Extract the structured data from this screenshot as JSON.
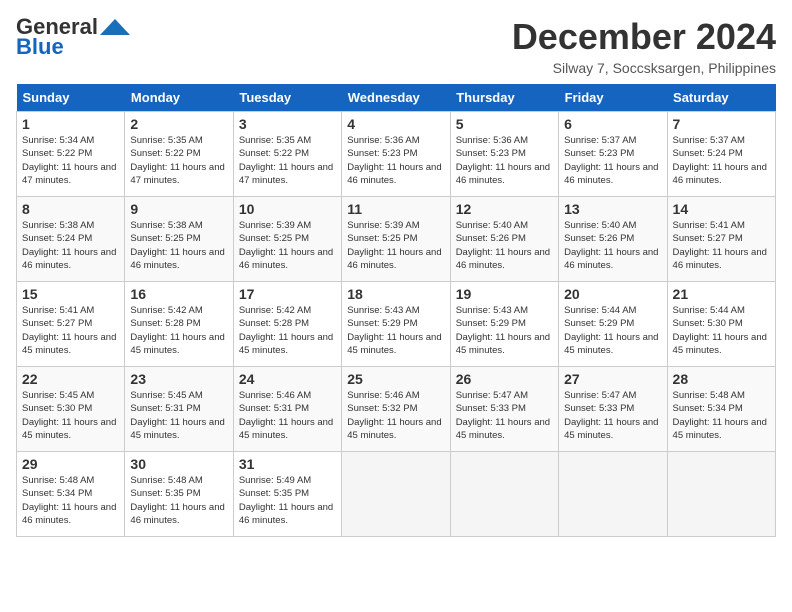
{
  "header": {
    "logo_line1": "General",
    "logo_line2": "Blue",
    "month_title": "December 2024",
    "location": "Silway 7, Soccsksargen, Philippines"
  },
  "weekdays": [
    "Sunday",
    "Monday",
    "Tuesday",
    "Wednesday",
    "Thursday",
    "Friday",
    "Saturday"
  ],
  "weeks": [
    [
      {
        "day": 1,
        "sunrise": "5:34 AM",
        "sunset": "5:22 PM",
        "daylight": "11 hours and 47 minutes."
      },
      {
        "day": 2,
        "sunrise": "5:35 AM",
        "sunset": "5:22 PM",
        "daylight": "11 hours and 47 minutes."
      },
      {
        "day": 3,
        "sunrise": "5:35 AM",
        "sunset": "5:22 PM",
        "daylight": "11 hours and 47 minutes."
      },
      {
        "day": 4,
        "sunrise": "5:36 AM",
        "sunset": "5:23 PM",
        "daylight": "11 hours and 46 minutes."
      },
      {
        "day": 5,
        "sunrise": "5:36 AM",
        "sunset": "5:23 PM",
        "daylight": "11 hours and 46 minutes."
      },
      {
        "day": 6,
        "sunrise": "5:37 AM",
        "sunset": "5:23 PM",
        "daylight": "11 hours and 46 minutes."
      },
      {
        "day": 7,
        "sunrise": "5:37 AM",
        "sunset": "5:24 PM",
        "daylight": "11 hours and 46 minutes."
      }
    ],
    [
      {
        "day": 8,
        "sunrise": "5:38 AM",
        "sunset": "5:24 PM",
        "daylight": "11 hours and 46 minutes."
      },
      {
        "day": 9,
        "sunrise": "5:38 AM",
        "sunset": "5:25 PM",
        "daylight": "11 hours and 46 minutes."
      },
      {
        "day": 10,
        "sunrise": "5:39 AM",
        "sunset": "5:25 PM",
        "daylight": "11 hours and 46 minutes."
      },
      {
        "day": 11,
        "sunrise": "5:39 AM",
        "sunset": "5:25 PM",
        "daylight": "11 hours and 46 minutes."
      },
      {
        "day": 12,
        "sunrise": "5:40 AM",
        "sunset": "5:26 PM",
        "daylight": "11 hours and 46 minutes."
      },
      {
        "day": 13,
        "sunrise": "5:40 AM",
        "sunset": "5:26 PM",
        "daylight": "11 hours and 46 minutes."
      },
      {
        "day": 14,
        "sunrise": "5:41 AM",
        "sunset": "5:27 PM",
        "daylight": "11 hours and 46 minutes."
      }
    ],
    [
      {
        "day": 15,
        "sunrise": "5:41 AM",
        "sunset": "5:27 PM",
        "daylight": "11 hours and 45 minutes."
      },
      {
        "day": 16,
        "sunrise": "5:42 AM",
        "sunset": "5:28 PM",
        "daylight": "11 hours and 45 minutes."
      },
      {
        "day": 17,
        "sunrise": "5:42 AM",
        "sunset": "5:28 PM",
        "daylight": "11 hours and 45 minutes."
      },
      {
        "day": 18,
        "sunrise": "5:43 AM",
        "sunset": "5:29 PM",
        "daylight": "11 hours and 45 minutes."
      },
      {
        "day": 19,
        "sunrise": "5:43 AM",
        "sunset": "5:29 PM",
        "daylight": "11 hours and 45 minutes."
      },
      {
        "day": 20,
        "sunrise": "5:44 AM",
        "sunset": "5:29 PM",
        "daylight": "11 hours and 45 minutes."
      },
      {
        "day": 21,
        "sunrise": "5:44 AM",
        "sunset": "5:30 PM",
        "daylight": "11 hours and 45 minutes."
      }
    ],
    [
      {
        "day": 22,
        "sunrise": "5:45 AM",
        "sunset": "5:30 PM",
        "daylight": "11 hours and 45 minutes."
      },
      {
        "day": 23,
        "sunrise": "5:45 AM",
        "sunset": "5:31 PM",
        "daylight": "11 hours and 45 minutes."
      },
      {
        "day": 24,
        "sunrise": "5:46 AM",
        "sunset": "5:31 PM",
        "daylight": "11 hours and 45 minutes."
      },
      {
        "day": 25,
        "sunrise": "5:46 AM",
        "sunset": "5:32 PM",
        "daylight": "11 hours and 45 minutes."
      },
      {
        "day": 26,
        "sunrise": "5:47 AM",
        "sunset": "5:33 PM",
        "daylight": "11 hours and 45 minutes."
      },
      {
        "day": 27,
        "sunrise": "5:47 AM",
        "sunset": "5:33 PM",
        "daylight": "11 hours and 45 minutes."
      },
      {
        "day": 28,
        "sunrise": "5:48 AM",
        "sunset": "5:34 PM",
        "daylight": "11 hours and 45 minutes."
      }
    ],
    [
      {
        "day": 29,
        "sunrise": "5:48 AM",
        "sunset": "5:34 PM",
        "daylight": "11 hours and 46 minutes."
      },
      {
        "day": 30,
        "sunrise": "5:48 AM",
        "sunset": "5:35 PM",
        "daylight": "11 hours and 46 minutes."
      },
      {
        "day": 31,
        "sunrise": "5:49 AM",
        "sunset": "5:35 PM",
        "daylight": "11 hours and 46 minutes."
      },
      null,
      null,
      null,
      null
    ]
  ]
}
